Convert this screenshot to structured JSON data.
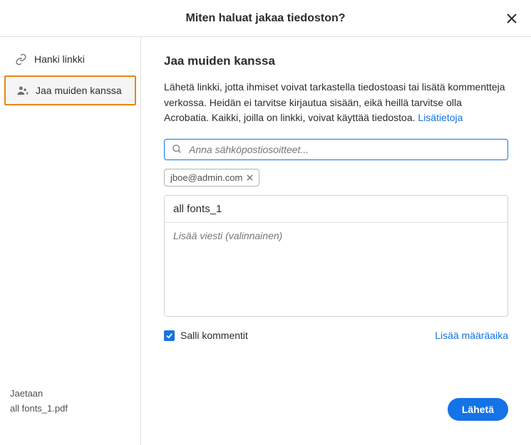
{
  "header": {
    "title": "Miten haluat jakaa tiedoston?"
  },
  "sidebar": {
    "items": [
      {
        "label": "Hanki linkki",
        "active": false
      },
      {
        "label": "Jaa muiden kanssa",
        "active": true
      }
    ],
    "footer_status": "Jaetaan",
    "footer_filename": "all fonts_1.pdf"
  },
  "main": {
    "title": "Jaa muiden kanssa",
    "description_part1": "Lähetä linkki, jotta ihmiset voivat tarkastella tiedostoasi tai lisätä kommentteja verkossa. Heidän ei tarvitse kirjautua sisään, eikä heillä tarvitse olla Acrobatia. Kaikki, joilla on linkki, voivat käyttää tiedostoa. ",
    "description_link": "Lisätietoja",
    "email_placeholder": "Anna sähköpostiosoitteet...",
    "chip_email": "jboe@admin.com",
    "subject_value": "all fonts_1",
    "message_placeholder": "Lisää viesti (valinnainen)",
    "allow_comments_label": "Salli kommentit",
    "deadline_link": "Lisää määräaika",
    "send_button": "Lähetä"
  }
}
